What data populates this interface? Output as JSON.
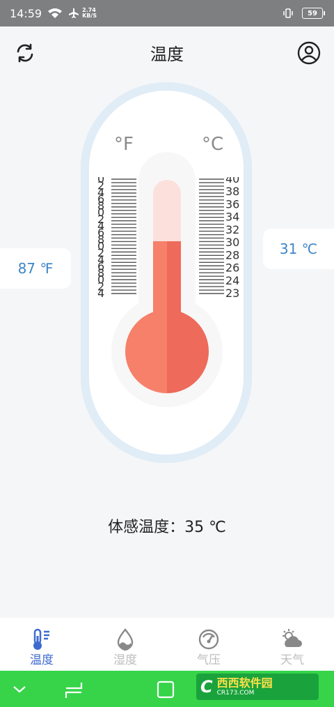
{
  "status_bar": {
    "time": "14:59",
    "speed_value": "2.74",
    "speed_unit": "KB/S",
    "battery": "59"
  },
  "header": {
    "title": "温度"
  },
  "thermometer": {
    "fahrenheit_unit": "°F",
    "celsius_unit": "°C",
    "fahrenheit_scale_labels": [
      "0",
      "2",
      "4",
      "6",
      "8",
      "0",
      "2",
      "4",
      "6",
      "8",
      "0",
      "2",
      "4",
      "6",
      "8",
      "0",
      "2",
      "4"
    ],
    "celsius_scale_labels": [
      "40",
      "38",
      "36",
      "34",
      "32",
      "30",
      "28",
      "26",
      "24",
      "23"
    ],
    "fill_fraction": 0.58
  },
  "readings": {
    "fahrenheit": "87 ℉",
    "celsius": "31 ℃"
  },
  "feels_like": "体感温度：35 ℃",
  "tabs": [
    {
      "label": "温度",
      "icon": "thermometer-icon",
      "active": true
    },
    {
      "label": "湿度",
      "icon": "humidity-drop-icon",
      "active": false
    },
    {
      "label": "气压",
      "icon": "pressure-gauge-icon",
      "active": false
    },
    {
      "label": "天气",
      "icon": "weather-cloud-icon",
      "active": false
    }
  ],
  "watermark": {
    "logo": "C",
    "brand": "西西软件园",
    "url": "CR173.COM"
  },
  "colors": {
    "accent": "#3e6bd0",
    "mercury": "#f6806a",
    "reading": "#3e86c6",
    "nav_bar": "#37d44a"
  }
}
